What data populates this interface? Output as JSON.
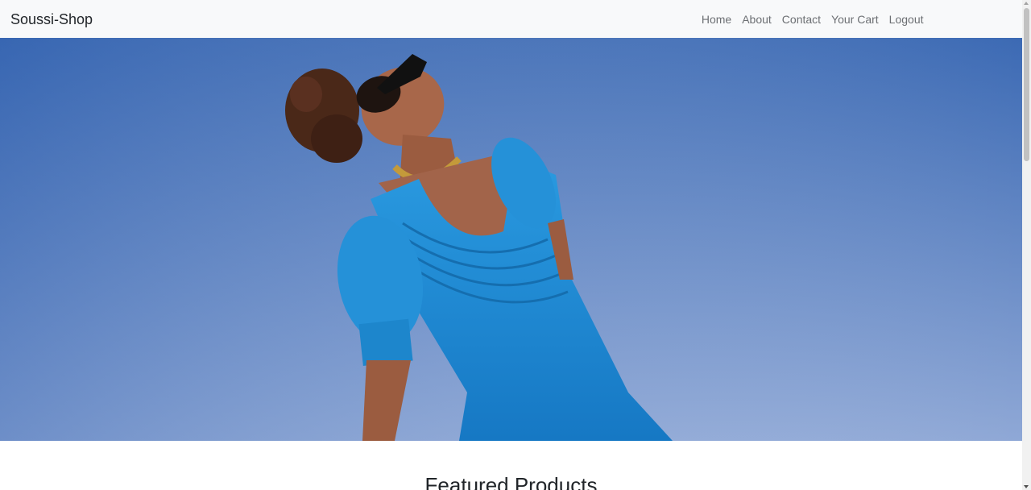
{
  "navbar": {
    "brand": "Soussi-Shop",
    "links": [
      {
        "label": "Home"
      },
      {
        "label": "About"
      },
      {
        "label": "Contact"
      },
      {
        "label": "Your Cart"
      },
      {
        "label": "Logout"
      }
    ]
  },
  "hero": {
    "sky_top_color": "#3c6ab4",
    "sky_bottom_color": "#8fa8d6",
    "dress_color": "#1f8fd4"
  },
  "featured": {
    "title": "Featured Products"
  }
}
